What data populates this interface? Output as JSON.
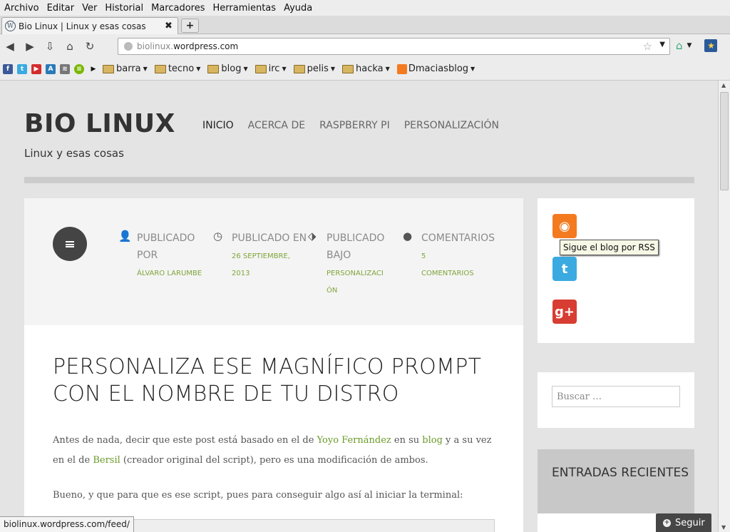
{
  "menubar": [
    "Archivo",
    "Editar",
    "Ver",
    "Historial",
    "Marcadores",
    "Herramientas",
    "Ayuda"
  ],
  "tab": {
    "title": "Bio Linux | Linux y esas cosas",
    "close": "✖",
    "new_tab": "+"
  },
  "navbar": {
    "url_domain": "biolinux.",
    "url_rest": "wordpress.com"
  },
  "bookmarks": {
    "folders": [
      "barra",
      "tecno",
      "blog",
      "irc",
      "pelis",
      "hacka"
    ],
    "feed": "Dmaciasblog"
  },
  "site": {
    "title": "BIO LINUX",
    "description": "Linux y esas cosas",
    "nav": [
      "INICIO",
      "ACERCA DE",
      "RASPBERRY PI",
      "PERSONALIZACIÓN"
    ]
  },
  "meta": [
    {
      "label": "PUBLICADO POR",
      "value": "ÁLVARO LARUMBE",
      "icon": "person-icon"
    },
    {
      "label": "PUBLICADO EN",
      "value": "26 SEPTIEMBRE, 2013",
      "icon": "clock-icon"
    },
    {
      "label": "PUBLICADO BAJO",
      "value": "PERSONALIZACIÓN",
      "icon": "tag-icon"
    },
    {
      "label": "COMENTARIOS",
      "value": "5 COMENTARIOS",
      "icon": "comment-icon"
    }
  ],
  "post": {
    "title": "PERSONALIZA ESE MAGNÍFICO PROMPT CON EL NOMBRE DE TU DISTRO",
    "p1_a": "Antes de nada, decir que este post está basado en el de ",
    "p1_link1": "Yoyo Fernández",
    "p1_b": " en su ",
    "p1_link2": "blog",
    "p1_c": " y a su vez en el de ",
    "p1_link3": "Bersil",
    "p1_d": " (creador original del script), pero es una modificación de ambos.",
    "p2": "Bueno, y que para que es ese script, pues para conseguir algo así al iniciar la terminal:"
  },
  "sidebar": {
    "tooltip": "Sigue el blog por RSS",
    "search_placeholder": "Buscar …",
    "recent_title": "ENTRADAS RECIENTES"
  },
  "follow": "Seguir",
  "status": "biolinux.wordpress.com/feed/",
  "colors": {
    "accent": "#7fa53a",
    "rss": "#f47a20",
    "twitter": "#3aaae1",
    "gplus": "#d73d32"
  }
}
